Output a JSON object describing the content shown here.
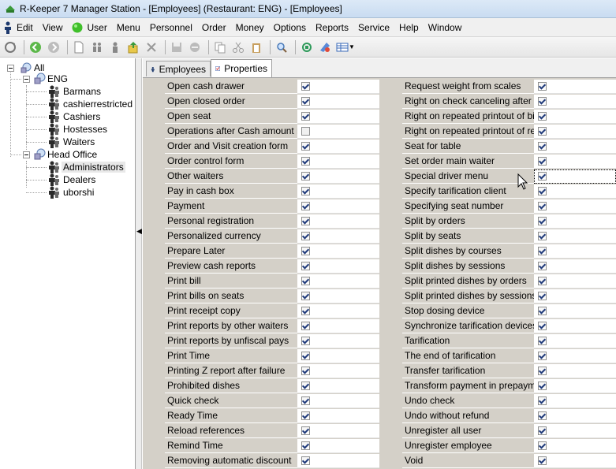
{
  "window": {
    "title": "R-Keeper 7 Manager Station - [Employees] (Restaurant: ENG) - [Employees]"
  },
  "menu": [
    "Edit",
    "View",
    "User",
    "Menu",
    "Personnel",
    "Order",
    "Money",
    "Options",
    "Reports",
    "Service",
    "Help",
    "Window"
  ],
  "toolbar_icons": [
    "refresh-icon",
    "back-icon",
    "forward-icon",
    "new-document-icon",
    "users-icon",
    "user-icon",
    "export-icon",
    "delete-icon",
    "save-icon",
    "cancel-icon",
    "copy-icon",
    "paste-icon",
    "find-icon",
    "sync-icon",
    "palette-icon",
    "grid-view-icon"
  ],
  "tree": {
    "root": "All",
    "groups": [
      {
        "label": "ENG",
        "children": [
          "Barmans",
          "cashierrestricted",
          "Cashiers",
          "Hostesses",
          "Waiters"
        ]
      },
      {
        "label": "Head Office",
        "children": [
          "Administrators",
          "Dealers",
          "uborshi"
        ]
      }
    ],
    "selected": "Administrators"
  },
  "tabs": {
    "employees": "Employees",
    "properties": "Properties"
  },
  "properties_left": [
    {
      "label": "Open cash drawer",
      "checked": true
    },
    {
      "label": "Open closed order",
      "checked": true
    },
    {
      "label": "Open seat",
      "checked": true
    },
    {
      "label": "Operations after Cash amount max",
      "checked": false
    },
    {
      "label": "Order and Visit creation form",
      "checked": true
    },
    {
      "label": "Order control form",
      "checked": true
    },
    {
      "label": "Other waiters",
      "checked": true
    },
    {
      "label": "Pay in cash box",
      "checked": true
    },
    {
      "label": "Payment",
      "checked": true
    },
    {
      "label": "Personal registration",
      "checked": true
    },
    {
      "label": "Personalized currency",
      "checked": true
    },
    {
      "label": "Prepare Later",
      "checked": true
    },
    {
      "label": "Preview cash reports",
      "checked": true
    },
    {
      "label": "Print bill",
      "checked": true
    },
    {
      "label": "Print bills on seats",
      "checked": true
    },
    {
      "label": "Print receipt copy",
      "checked": true
    },
    {
      "label": "Print reports by other waiters",
      "checked": true
    },
    {
      "label": "Print reports by unfiscal pays",
      "checked": true
    },
    {
      "label": "Print Time",
      "checked": true
    },
    {
      "label": "Printing Z report after failure",
      "checked": true
    },
    {
      "label": "Prohibited dishes",
      "checked": true
    },
    {
      "label": "Quick check",
      "checked": true
    },
    {
      "label": "Ready Time",
      "checked": true
    },
    {
      "label": "Reload references",
      "checked": true
    },
    {
      "label": "Remind Time",
      "checked": true
    },
    {
      "label": "Removing automatic discount",
      "checked": true
    }
  ],
  "properties_right": [
    {
      "label": "Request weight from scales",
      "checked": true
    },
    {
      "label": "Right on check canceling after pri",
      "checked": true
    },
    {
      "label": "Right on repeated printout of bill",
      "checked": true
    },
    {
      "label": "Right on repeated printout of recei",
      "checked": true
    },
    {
      "label": "Seat for table",
      "checked": true
    },
    {
      "label": "Set order main waiter",
      "checked": true
    },
    {
      "label": "Special driver menu",
      "checked": true
    },
    {
      "label": "Specify tarification client",
      "checked": true
    },
    {
      "label": "Specifying seat number",
      "checked": true
    },
    {
      "label": "Split by orders",
      "checked": true
    },
    {
      "label": "Split by seats",
      "checked": true
    },
    {
      "label": "Split dishes by courses",
      "checked": true
    },
    {
      "label": "Split dishes by sessions",
      "checked": true
    },
    {
      "label": "Split printed dishes by orders",
      "checked": true
    },
    {
      "label": "Split printed dishes by sessions",
      "checked": true
    },
    {
      "label": "Stop dosing device",
      "checked": true
    },
    {
      "label": "Synchronize tarification devices",
      "checked": true
    },
    {
      "label": "Tarification",
      "checked": true
    },
    {
      "label": "The end of tarification",
      "checked": true
    },
    {
      "label": "Transfer tarification",
      "checked": true
    },
    {
      "label": "Transform payment in prepayment",
      "checked": true
    },
    {
      "label": "Undo check",
      "checked": true
    },
    {
      "label": "Undo without refund",
      "checked": true
    },
    {
      "label": "Unregister all user",
      "checked": true
    },
    {
      "label": "Unregister employee",
      "checked": true
    },
    {
      "label": "Void",
      "checked": true
    }
  ],
  "focused_property": "Special driver menu",
  "colors": {
    "grid_label_bg": "#d4d0c8",
    "titlebar": "#c9dcf1",
    "check": "#1f3a7a"
  }
}
